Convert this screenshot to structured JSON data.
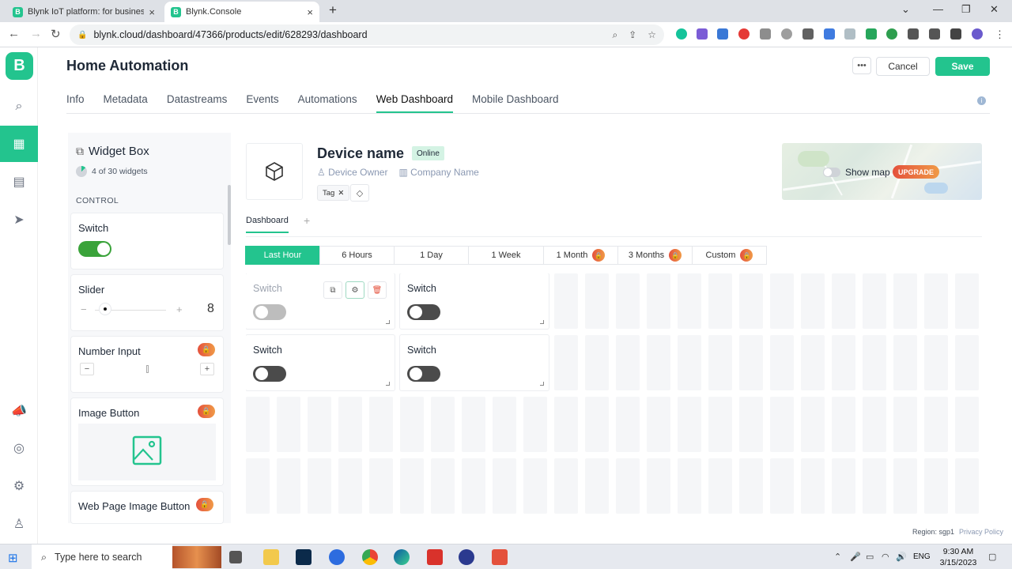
{
  "browser": {
    "tabs": [
      {
        "title": "Blynk IoT platform: for businesses",
        "favicon": "B"
      },
      {
        "title": "Blynk.Console",
        "favicon": "B"
      }
    ],
    "url": "blynk.cloud/dashboard/47366/products/edit/628293/dashboard"
  },
  "app": {
    "logo": "B",
    "brand_color": "#23c48e"
  },
  "header": {
    "title": "Home Automation",
    "more_label": "•••",
    "cancel_label": "Cancel",
    "save_label": "Save"
  },
  "tabs": [
    "Info",
    "Metadata",
    "Datastreams",
    "Events",
    "Automations",
    "Web Dashboard",
    "Mobile Dashboard"
  ],
  "widget_box": {
    "title": "Widget Box",
    "count": "4 of 30 widgets",
    "count_fraction": 0.133,
    "section": "CONTROL",
    "widgets": [
      {
        "name": "Switch",
        "locked": false
      },
      {
        "name": "Slider",
        "locked": false,
        "value": "8",
        "minus": "−",
        "plus": "+"
      },
      {
        "name": "Number Input",
        "locked": true,
        "minus": "−",
        "plus": "+"
      },
      {
        "name": "Image Button",
        "locked": true
      },
      {
        "name": "Web Page Image Button",
        "locked": true
      }
    ]
  },
  "device": {
    "name": "Device name",
    "status": "Online",
    "owner": "Device Owner",
    "company": "Company Name",
    "tag": "Tag",
    "show_map": "Show map",
    "upgrade": "UPGRADE"
  },
  "dashboard": {
    "tab": "Dashboard",
    "add": "+",
    "ranges": [
      {
        "label": "Last Hour",
        "locked": false,
        "active": true
      },
      {
        "label": "6 Hours",
        "locked": false,
        "active": false
      },
      {
        "label": "1 Day",
        "locked": false,
        "active": false
      },
      {
        "label": "1 Week",
        "locked": false,
        "active": false
      },
      {
        "label": "1 Month",
        "locked": true,
        "active": false
      },
      {
        "label": "3 Months",
        "locked": true,
        "active": false
      },
      {
        "label": "Custom",
        "locked": true,
        "active": false
      }
    ],
    "widgets": [
      {
        "name": "Switch",
        "state": "off",
        "selected": true
      },
      {
        "name": "Switch",
        "state": "off",
        "selected": false
      },
      {
        "name": "Switch",
        "state": "off",
        "selected": false
      },
      {
        "name": "Switch",
        "state": "off",
        "selected": false
      }
    ]
  },
  "footer": {
    "region": "Region: sgp1",
    "privacy": "Privacy Policy"
  },
  "taskbar": {
    "search_placeholder": "Type here to search",
    "lang": "ENG",
    "time": "9:30 AM",
    "date": "3/15/2023"
  }
}
